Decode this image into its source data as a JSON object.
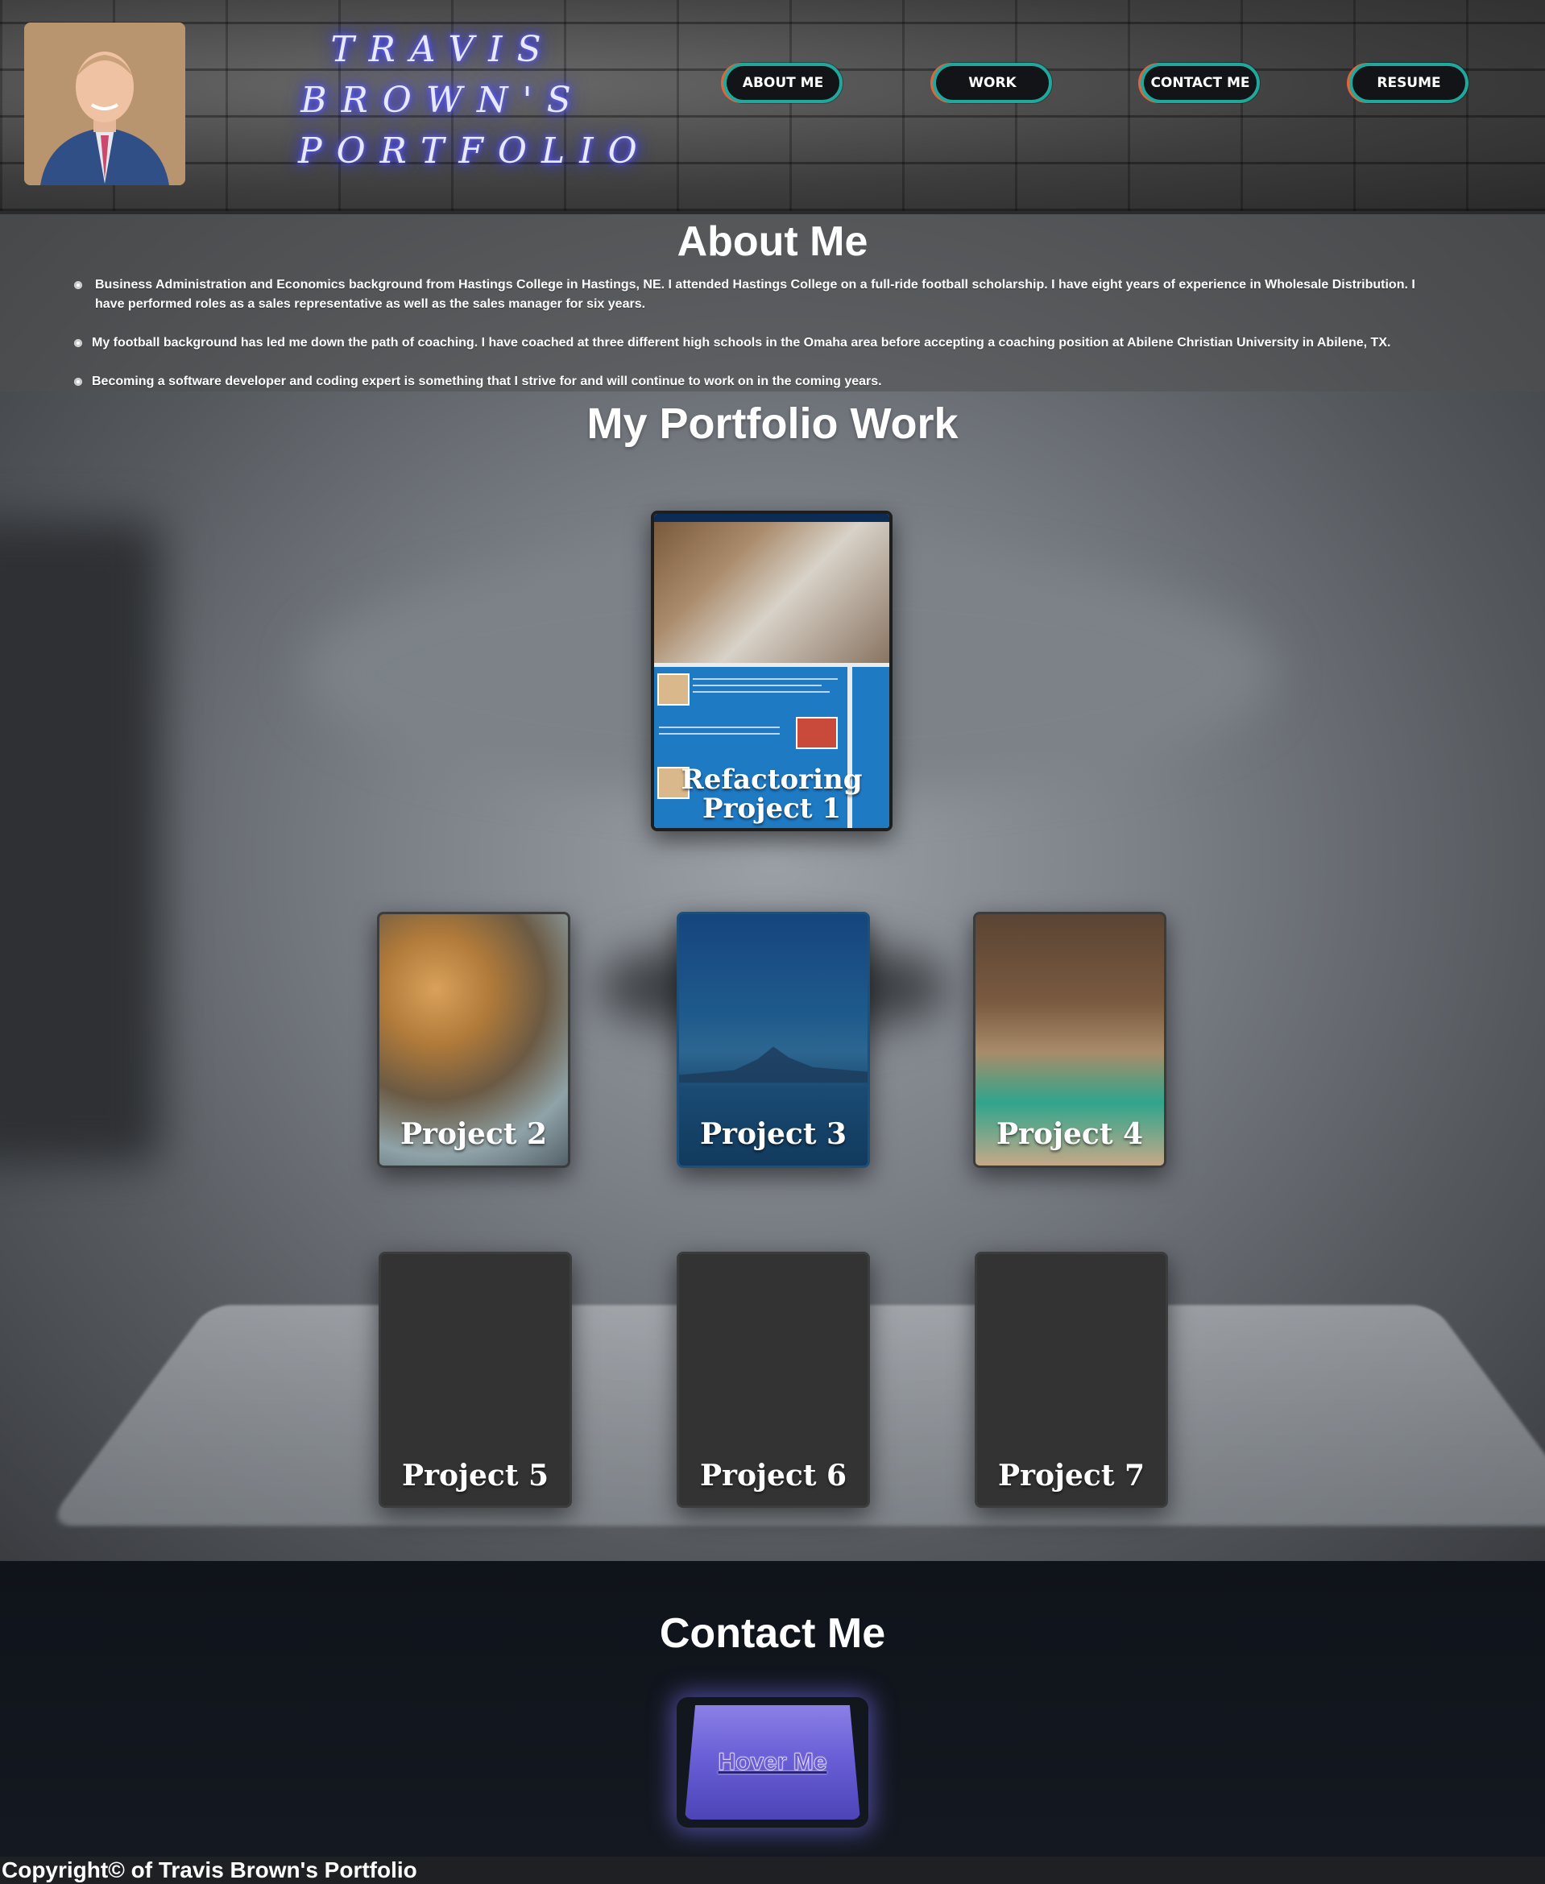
{
  "header": {
    "title_lines": [
      "TRAVIS",
      "BROWN'S",
      "PORTFOLIO"
    ],
    "nav": [
      {
        "label": "ABOUT ME"
      },
      {
        "label": "WORK"
      },
      {
        "label": "CONTACT ME"
      },
      {
        "label": "RESUME"
      }
    ]
  },
  "about": {
    "title": "About Me",
    "items": [
      "Business Administration and Economics background from Hastings College in Hastings, NE. I attended Hastings College on a full-ride football scholarship. I have eight years of experience in Wholesale Distribution. I have performed roles as a sales representative as well as the sales manager for six years.",
      "My football background has led me down the path of coaching. I have coached at three different high schools in the Omaha area before accepting a coaching position at Abilene Christian University in Abilene, TX.",
      "Becoming a software developer and coding expert is something that I strive for and will continue to work on in the coming years."
    ]
  },
  "portfolio": {
    "title": "My Portfolio Work",
    "projects": [
      {
        "line1": "Refactoring",
        "line2": "Project 1"
      },
      {
        "label": "Project 2"
      },
      {
        "label": "Project 3"
      },
      {
        "label": "Project 4"
      },
      {
        "label": "Project 5"
      },
      {
        "label": "Project 6"
      },
      {
        "label": "Project 7"
      }
    ]
  },
  "contact": {
    "title": "Contact Me",
    "button_label": "Hover Me"
  },
  "footer": {
    "copyright": "Copyright© of Travis Brown's Portfolio"
  },
  "colors": {
    "nav_ring_teal": "#1fa89c",
    "nav_ring_orange": "#e8633a",
    "button_purple": "#6a5fd6"
  }
}
